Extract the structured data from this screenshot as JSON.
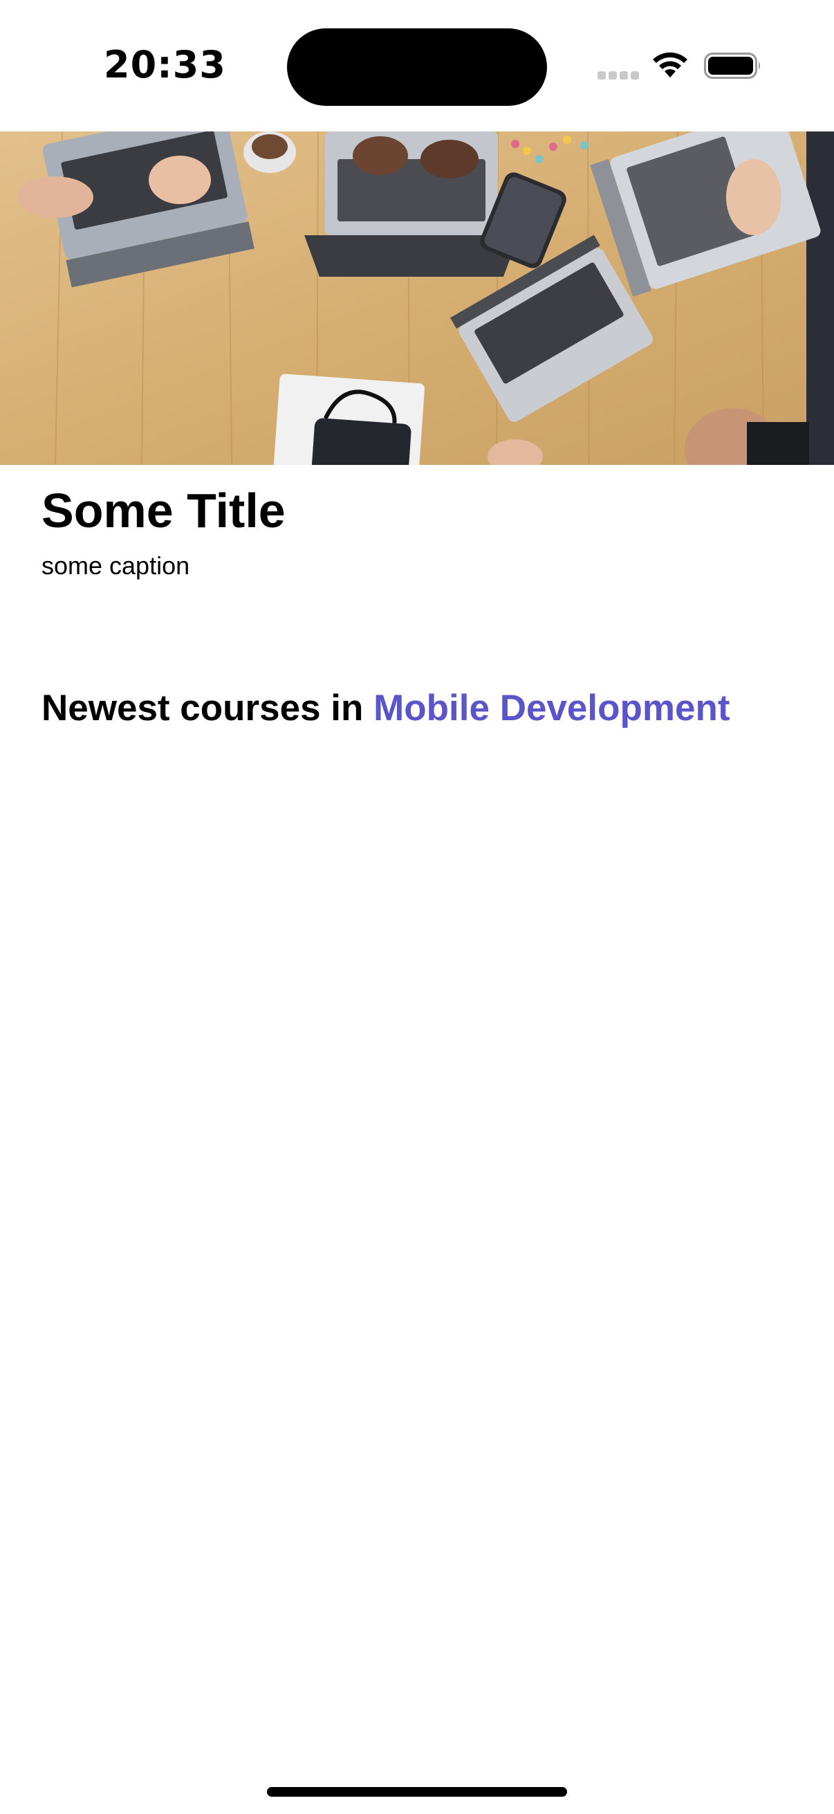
{
  "status_bar": {
    "time": "20:33",
    "icons": [
      "cellular-signal-icon",
      "wifi-icon",
      "battery-icon"
    ]
  },
  "hero": {
    "image": "Overhead photo of hands typing on several laptops on a wooden table"
  },
  "card": {
    "title": "Some Title",
    "caption": "some caption"
  },
  "section": {
    "heading_prefix": "Newest courses in ",
    "heading_category": "Mobile Development",
    "accent_color": "#5a55c9"
  }
}
